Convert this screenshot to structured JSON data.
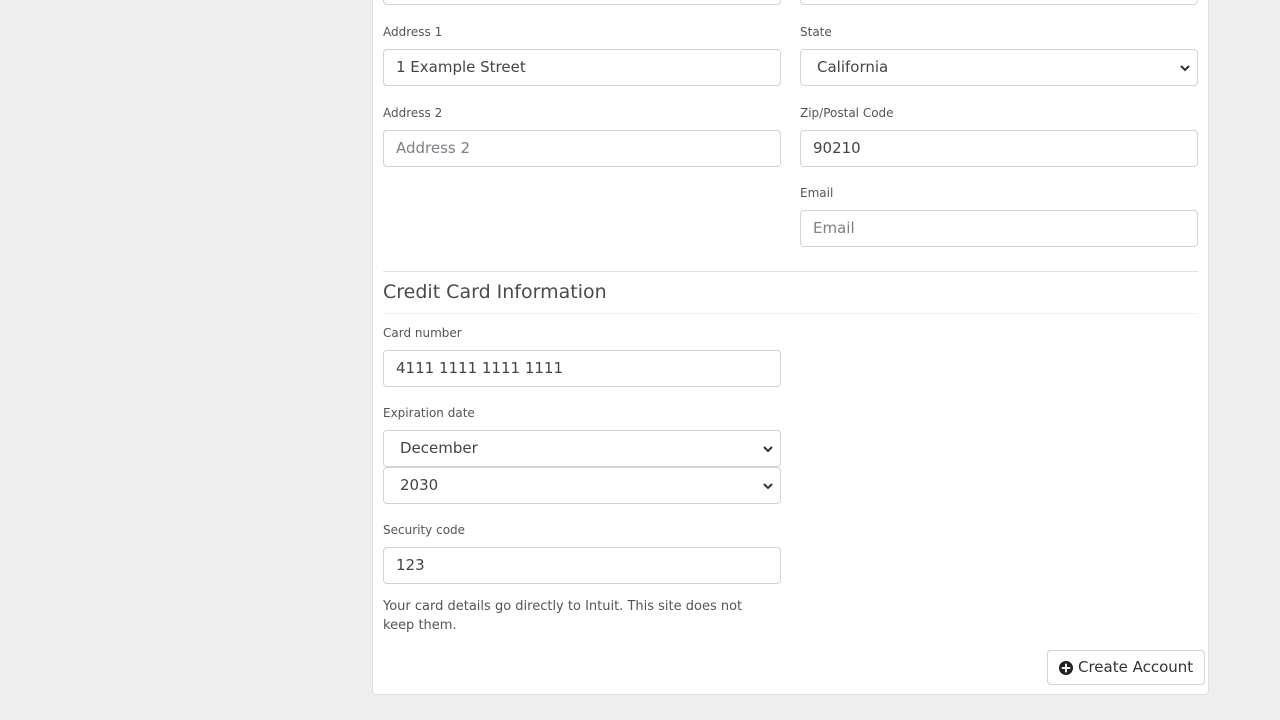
{
  "form": {
    "address1": {
      "label": "Address 1",
      "value": "1 Example Street"
    },
    "address2": {
      "label": "Address 2",
      "placeholder": "Address 2"
    },
    "state": {
      "label": "State",
      "value": "California"
    },
    "zip": {
      "label": "Zip/Postal Code",
      "value": "90210"
    },
    "email": {
      "label": "Email",
      "placeholder": "Email"
    }
  },
  "credit_card": {
    "title": "Credit Card Information",
    "card_number": {
      "label": "Card number",
      "value": "4111 1111 1111 1111"
    },
    "expiration": {
      "label": "Expiration date",
      "month": "December",
      "year": "2030"
    },
    "security_code": {
      "label": "Security code",
      "value": "123"
    },
    "help_text": "Your card details go directly to Intuit. This site does not keep them."
  },
  "actions": {
    "create_account_label": "Create Account",
    "create_account_icon": "plus-circle-icon"
  }
}
